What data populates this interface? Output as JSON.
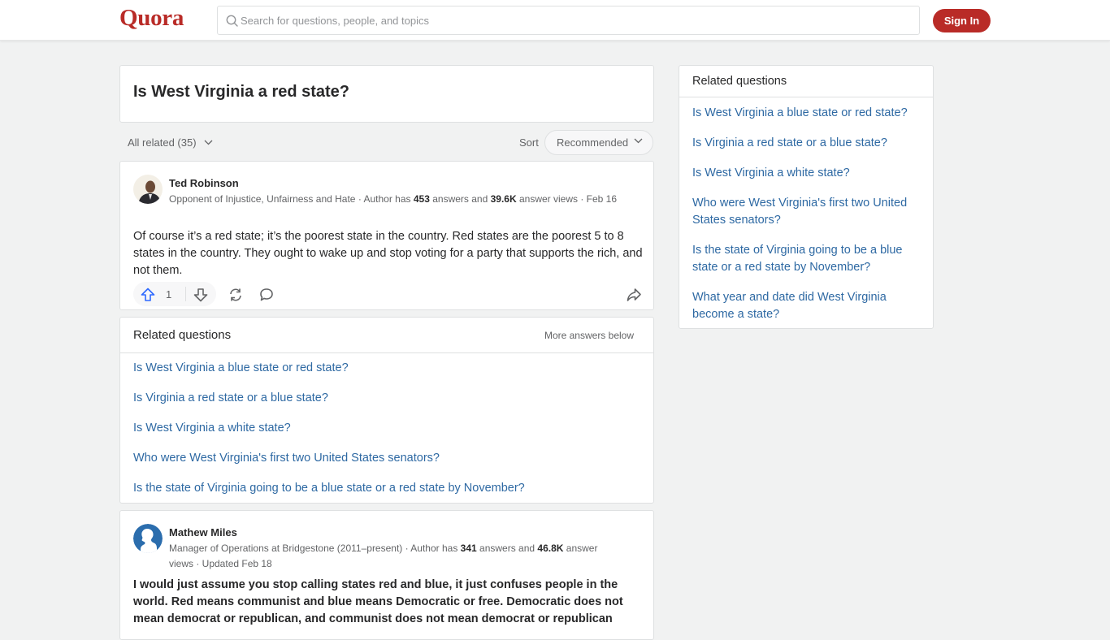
{
  "header": {
    "logo": "Quora",
    "search_placeholder": "Search for questions, people, and topics",
    "signin_label": "Sign In"
  },
  "question": {
    "title": "Is West Virginia a red state?"
  },
  "filter": {
    "all_related_label": "All related (35)",
    "sort_label": "Sort",
    "sort_value": "Recommended"
  },
  "answers": [
    {
      "author": "Ted Robinson",
      "credential": "Opponent of Injustice, Unfairness and Hate",
      "answers_count": "453",
      "views": "39.6K",
      "date": "Feb 16",
      "cred_prefix": " · Author has ",
      "cred_mid": " answers and ",
      "cred_suffix": " answer views · ",
      "body": "Of course it’s a red state; it’s the poorest state in the country. Red states are the poorest 5 to 8 states in the country. They ought to wake up and stop voting for a party that supports the rich, and not them.",
      "upvotes": "1"
    },
    {
      "author": "Mathew Miles",
      "credential": "Manager of Operations at Bridgestone (2011–present)",
      "answers_count": "341",
      "views": "46.8K",
      "date": "Updated Feb 18",
      "cred_prefix": " · Author has ",
      "cred_mid": " answers and ",
      "cred_suffix": " answer views · ",
      "body": "I would just assume you stop calling states red and blue, it just confuses people in the world. Red means communist and blue means Democratic or free. Democratic does not mean democrat or republican, and communist does not mean democrat or republican"
    }
  ],
  "inline_related": {
    "title": "Related questions",
    "more_label": "More answers below",
    "items": [
      "Is West Virginia a blue state or red state?",
      "Is Virginia a red state or a blue state?",
      "Is West Virginia a white state?",
      "Who were West Virginia's first two United States senators?",
      "Is the state of Virginia going to be a blue state or a red state by November?"
    ]
  },
  "sidebar_related": {
    "title": "Related questions",
    "items": [
      "Is West Virginia a blue state or red state?",
      "Is Virginia a red state or a blue state?",
      "Is West Virginia a white state?",
      "Who were West Virginia's first two United States senators?",
      "Is the state of Virginia going to be a blue state or a red state by November?",
      "What year and date did West Virginia become a state?"
    ]
  },
  "colors": {
    "brand": "#b92b27",
    "link": "#2e69a3",
    "upvote": "#2e69ff",
    "background": "#f1f2f2"
  }
}
